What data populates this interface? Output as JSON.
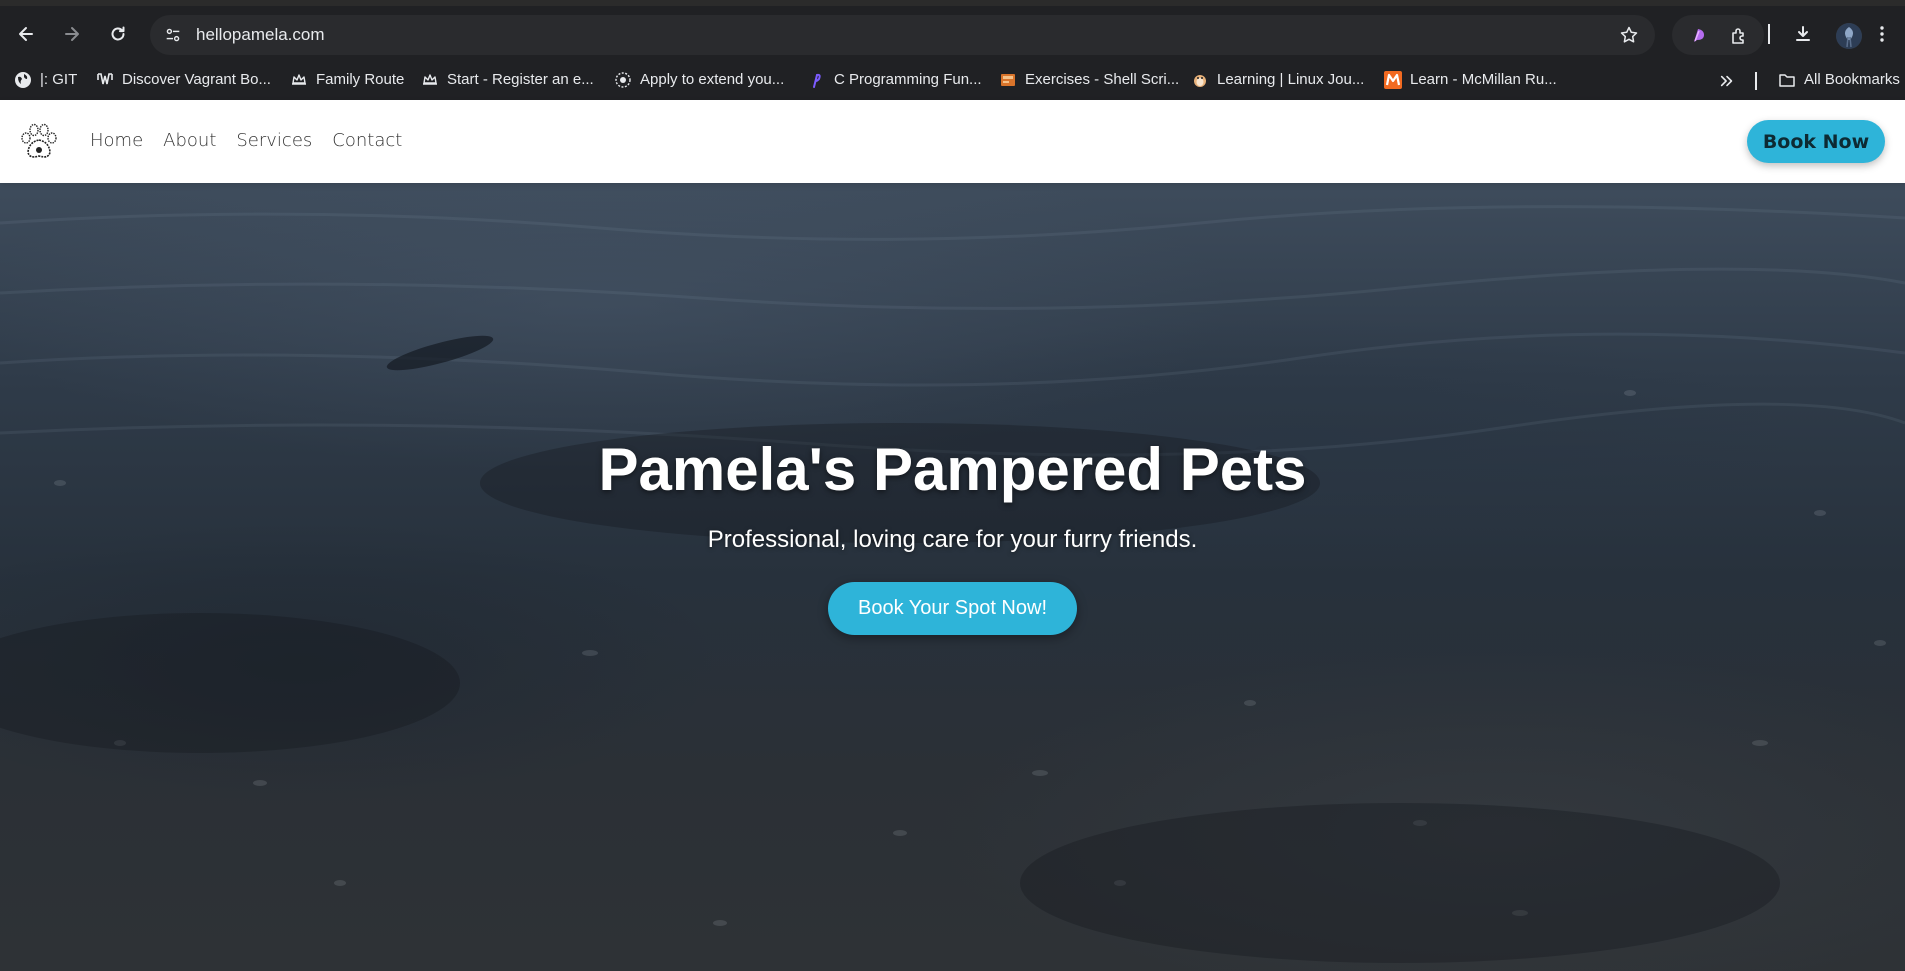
{
  "browser": {
    "url": "hellopamela.com",
    "bookmarks": [
      {
        "label": "|: GIT",
        "icon": "globe-icon"
      },
      {
        "label": "Discover Vagrant Bo...",
        "icon": "vagrant-icon"
      },
      {
        "label": "Family Route",
        "icon": "crown-icon"
      },
      {
        "label": "Start - Register an e...",
        "icon": "crown-icon"
      },
      {
        "label": "Apply to extend you...",
        "icon": "crest-icon"
      },
      {
        "label": "C Programming Fun...",
        "icon": "feather-icon"
      },
      {
        "label": "Exercises - Shell Scri...",
        "icon": "book-icon"
      },
      {
        "label": "Learning | Linux Jou...",
        "icon": "penguin-icon"
      },
      {
        "label": "Learn - McMillan Ru...",
        "icon": "m-logo-icon"
      }
    ],
    "all_bookmarks_label": "All Bookmarks"
  },
  "site": {
    "nav": {
      "links": [
        "Home",
        "About",
        "Services",
        "Contact"
      ],
      "book_now": "Book Now"
    },
    "hero": {
      "title": "Pamela's Pampered Pets",
      "subtitle": "Professional, loving care for your furry friends.",
      "cta": "Book Your Spot Now!"
    },
    "colors": {
      "accent": "#2eb4d9",
      "chrome_bg": "#202124",
      "hero_dark": "#2f3b49"
    }
  }
}
